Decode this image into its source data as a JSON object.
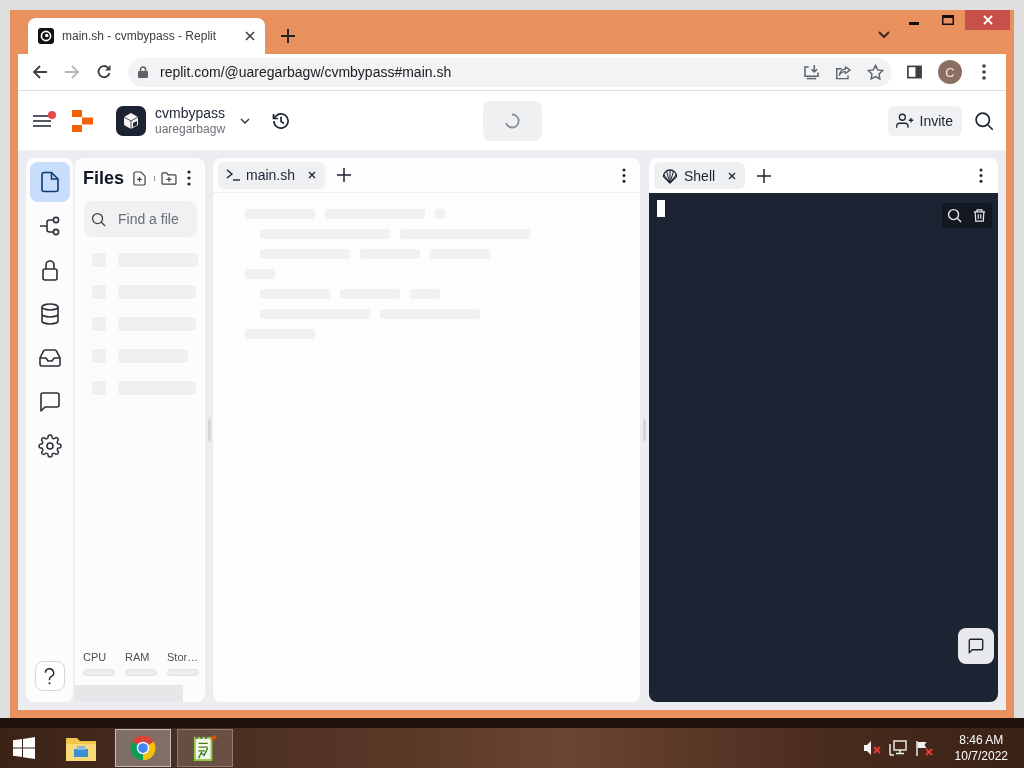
{
  "browser": {
    "tabs": [
      {
        "title": "main.sh - cvmbypass - Replit",
        "selected": true
      }
    ],
    "nav_buttons": [
      {
        "kind": "back",
        "disabled": false
      },
      {
        "kind": "forward",
        "disabled": true
      },
      {
        "kind": "reload",
        "disabled": false
      }
    ],
    "url": "replit.com/@uaregarbagw/cvmbypass#main.sh",
    "profile_initial": "C"
  },
  "header": {
    "menu_notification": true,
    "repl_name": "cvmbypass",
    "owner": "uaregarbagw",
    "run_loading": true,
    "invite_label": "Invite"
  },
  "rail": [
    {
      "kind": "file",
      "selected": true
    },
    {
      "kind": "branch",
      "selected": false
    },
    {
      "kind": "lock",
      "selected": false
    },
    {
      "kind": "database",
      "selected": false
    },
    {
      "kind": "tray",
      "selected": false
    },
    {
      "kind": "chat",
      "selected": false
    },
    {
      "kind": "gear",
      "selected": false
    }
  ],
  "files_panel": {
    "title": "Files",
    "search": {
      "placeholder": "Find a file"
    },
    "resources": [
      {
        "label": "CPU"
      },
      {
        "label": "RAM"
      },
      {
        "label": "Stor…"
      }
    ]
  },
  "editor": {
    "tabs": [
      {
        "label": "main.sh",
        "selected": true
      }
    ]
  },
  "shell": {
    "tabs": [
      {
        "label": "Shell",
        "selected": true
      }
    ]
  },
  "taskbar": {
    "apps": [
      {
        "kind": "folder",
        "running": false,
        "selected": false
      },
      {
        "kind": "browser",
        "running": true,
        "selected": true
      },
      {
        "kind": "notepad",
        "running": true,
        "selected": false
      }
    ],
    "time": "8:46 AM",
    "date": "10/7/2022"
  }
}
